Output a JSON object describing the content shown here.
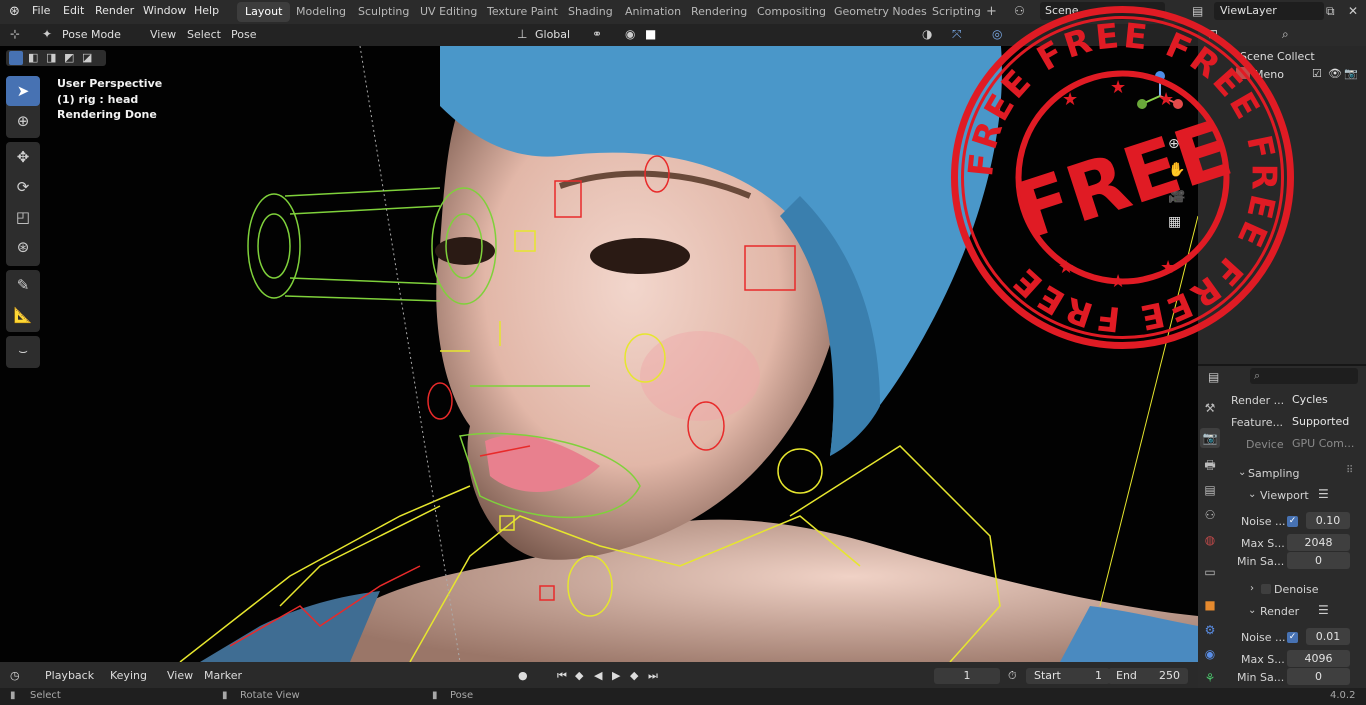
{
  "topbar": {
    "menu": [
      "File",
      "Edit",
      "Render",
      "Window",
      "Help"
    ],
    "workspaces": [
      "Layout",
      "Modeling",
      "Sculpting",
      "UV Editing",
      "Texture Paint",
      "Shading",
      "Animation",
      "Rendering",
      "Compositing",
      "Geometry Nodes",
      "Scripting"
    ],
    "active_workspace": "Layout",
    "add_tab": "+",
    "scene": "Scene",
    "view_layer": "ViewLayer"
  },
  "viewport_header": {
    "mode": "Pose Mode",
    "menus": [
      "View",
      "Select",
      "Pose"
    ],
    "orientation": "Global",
    "pose_options": "Pose Options"
  },
  "overlay": {
    "line1": "User Perspective",
    "line2": "(1) rig : head",
    "line3": "Rendering Done"
  },
  "outliner": {
    "row1": "Scene Collect",
    "row2": "Meno"
  },
  "properties": {
    "render_engine_label": "Render ...",
    "render_engine": "Cycles",
    "feature_label": "Feature...",
    "feature_value": "Supported",
    "device_label": "Device",
    "device_value": "GPU Com...",
    "sampling": "Sampling",
    "viewport": "Viewport",
    "vp_noise_label": "Noise ...",
    "vp_noise_value": "0.10",
    "vp_max_label": "Max S...",
    "vp_max_value": "2048",
    "vp_min_label": "Min Sa...",
    "vp_min_value": "0",
    "denoise": "Denoise",
    "render": "Render",
    "r_noise_label": "Noise ...",
    "r_noise_value": "0.01",
    "r_max_label": "Max S...",
    "r_max_value": "4096",
    "r_min_label": "Min Sa...",
    "r_min_value": "0"
  },
  "timeline": {
    "menus": [
      "Playback",
      "Keying",
      "View",
      "Marker"
    ],
    "current_frame": "1",
    "start_label": "Start",
    "start_value": "1",
    "end_label": "End",
    "end_value": "250"
  },
  "statusbar": {
    "select": "Select",
    "rotate": "Rotate View",
    "pose": "Pose",
    "version": "4.0.2"
  },
  "stamp": {
    "center": "FREE",
    "ring": "FREE FREE FREE FREE FREE FREE"
  },
  "colors": {
    "accent": "#4772b3",
    "stamp_red": "#e01b24",
    "bone_yellow": "#e6e62e",
    "bone_green": "#7fd13b",
    "bone_red": "#e82a2a",
    "hat_blue": "#4a97c9"
  }
}
